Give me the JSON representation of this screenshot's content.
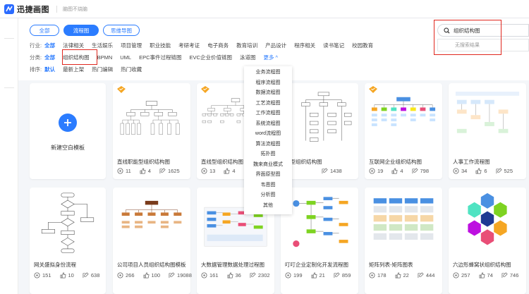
{
  "app": {
    "name": "迅捷画图",
    "slogan": "脑图不烧脑"
  },
  "colors": {
    "accent": "#2b7cff",
    "highlight_box": "#e0271e",
    "vip_badge": "#f5a623"
  },
  "tabs": [
    {
      "label": "全部",
      "active": false
    },
    {
      "label": "流程图",
      "active": true
    },
    {
      "label": "思维导图",
      "active": false
    }
  ],
  "industry": {
    "label": "行业:",
    "options": [
      "全部",
      "法律相关",
      "生活娱乐",
      "项目管理",
      "职业技能",
      "考研考证",
      "电子商务",
      "教育培训",
      "产品设计",
      "程序相关",
      "读书笔记",
      "校园教育"
    ]
  },
  "category": {
    "label": "分类:",
    "options": [
      "全部",
      "组织结构图",
      "BPMN",
      "UML",
      "EPC事件过程链图",
      "EVC企业价值链图",
      "泳道图"
    ],
    "more": "更多"
  },
  "sort": {
    "label": "排序:",
    "options": [
      "默认",
      "最新上架",
      "热门编辑",
      "热门收藏"
    ]
  },
  "search": {
    "value": "组织结构图",
    "no_result": "无搜索结果"
  },
  "more_dropdown": [
    "业务流程图",
    "程序流程图",
    "数据流程图",
    "工艺流程图",
    "工作流程图",
    "系统流程图",
    "word流程图",
    "算法流程图",
    "拓扑图",
    "魏来商业模式",
    "界面原型图",
    "韦恩图",
    "分析图",
    "其他"
  ],
  "new_template": {
    "label": "新建空白模板"
  },
  "cards_row1": [
    {
      "title": "直线职能型组织结构图",
      "views": "11",
      "likes": "4",
      "edits": "1625",
      "vip": true
    },
    {
      "title": "直线型组织结构图",
      "views": "13",
      "likes": "4",
      "edits": "",
      "vip": true
    },
    {
      "title": "能型组织结构图",
      "views": "",
      "likes": "",
      "edits": "1438",
      "vip": false
    },
    {
      "title": "互联网企业组织结构图",
      "views": "19",
      "likes": "4",
      "edits": "798",
      "vip": true
    },
    {
      "title": "人事工作流程图",
      "views": "34",
      "likes": "6",
      "edits": "525",
      "vip": false
    }
  ],
  "cards_row2": [
    {
      "title": "网关盛拟身份流程",
      "views": "151",
      "likes": "10",
      "edits": "638"
    },
    {
      "title": "公司项目人员组织结构图模板",
      "views": "266",
      "likes": "100",
      "edits": "19088"
    },
    {
      "title": "大数据管理数据处理过程图",
      "views": "161",
      "likes": "36",
      "edits": "2302"
    },
    {
      "title": "叮叮企业定制化开发流程图",
      "views": "199",
      "likes": "21",
      "edits": "859"
    },
    {
      "title": "矩阵列表-矩阵图表",
      "views": "178",
      "likes": "22",
      "edits": "444"
    },
    {
      "title": "六边形蜂窝状组织结构图",
      "views": "257",
      "likes": "74",
      "edits": "746"
    }
  ]
}
